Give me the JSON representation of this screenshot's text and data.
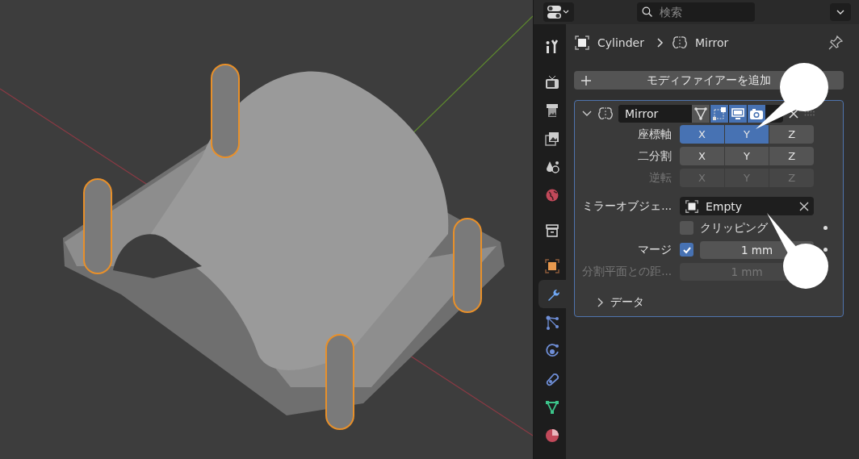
{
  "viewport": {
    "kind": "picture"
  },
  "header": {
    "search": {
      "placeholder": "検索"
    }
  },
  "tabs": [
    {
      "kind": "tool",
      "selected": false
    },
    {
      "kind": "render",
      "selected": false
    },
    {
      "kind": "output",
      "selected": false
    },
    {
      "kind": "view_layer",
      "selected": false
    },
    {
      "kind": "scene",
      "selected": false
    },
    {
      "kind": "world",
      "selected": false
    },
    {
      "kind": "collection",
      "selected": false
    },
    {
      "kind": "object",
      "selected": false
    },
    {
      "kind": "modifiers",
      "selected": true
    },
    {
      "kind": "particles",
      "selected": false
    },
    {
      "kind": "physics",
      "selected": false
    },
    {
      "kind": "constraints",
      "selected": false
    },
    {
      "kind": "data",
      "selected": false
    },
    {
      "kind": "material",
      "selected": false
    }
  ],
  "breadcrumb": [
    "Cylinder",
    "Mirror"
  ],
  "add_modifier_button": "モディファイアーを追加",
  "modifier": {
    "name": "Mirror",
    "expanded": true,
    "toggles": [
      {
        "kind": "on_cage",
        "on": false
      },
      {
        "kind": "edit_mode",
        "on": true
      },
      {
        "kind": "viewport",
        "on": true
      },
      {
        "kind": "render",
        "on": true
      }
    ],
    "axis_rows": [
      {
        "label": "座標軸",
        "disabled": false,
        "buttons": [
          {
            "label": "X",
            "selected": true
          },
          {
            "label": "Y",
            "selected": true
          },
          {
            "label": "Z",
            "selected": false
          }
        ]
      },
      {
        "label": "二分割",
        "disabled": false,
        "buttons": [
          {
            "label": "X",
            "selected": false
          },
          {
            "label": "Y",
            "selected": false
          },
          {
            "label": "Z",
            "selected": false
          }
        ]
      },
      {
        "label": "逆転",
        "disabled": true,
        "buttons": [
          {
            "label": "X",
            "selected": false
          },
          {
            "label": "Y",
            "selected": false
          },
          {
            "label": "Z",
            "selected": false
          }
        ]
      }
    ],
    "mirror_object": {
      "label": "ミラーオブジェ...",
      "value": "Empty"
    },
    "clipping": {
      "label": "クリッピング",
      "checked": false
    },
    "merge": {
      "label": "マージ",
      "checked": true,
      "value": "1 mm"
    },
    "bisect_distance": {
      "label": "分割平面との距...",
      "value": "1 mm",
      "disabled": true
    },
    "data_section": {
      "label": "データ",
      "expanded": false
    }
  }
}
